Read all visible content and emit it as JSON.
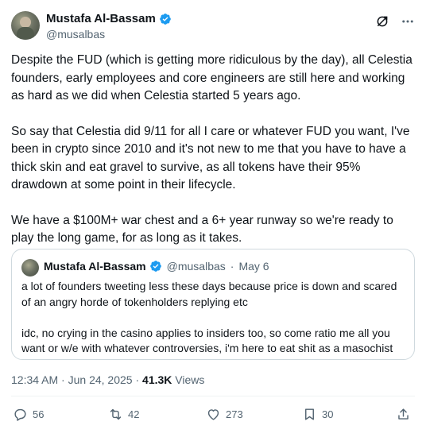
{
  "author": {
    "name": "Mustafa Al-Bassam",
    "handle": "@musalbas"
  },
  "tweet": {
    "paragraphs": [
      "Despite the FUD (which is getting more ridiculous by the day), all Celestia founders, early employees and core engineers are still here and working as hard as we did when Celestia started 5 years ago.",
      "So say that Celestia did 9/11 for all I care or whatever FUD you want, I've been in crypto since 2010 and it's not new to me that you have to have a thick skin and eat gravel to survive, as all tokens have their 95% drawdown at some point in their lifecycle.",
      "We have a $100M+ war chest and a 6+ year runway so we're ready to play the long game, for as long as it takes."
    ]
  },
  "quote": {
    "name": "Mustafa Al-Bassam",
    "handle": "@musalbas",
    "separator": "·",
    "date": "May 6",
    "paragraphs": [
      "a lot of founders tweeting less these days because price is down and scared of an angry horde of tokenholders replying etc",
      "idc, no crying in the casino applies to insiders too, so come ratio me all you want or w/e with whatever controversies, i'm here to eat shit as a masochist"
    ]
  },
  "meta": {
    "time": "12:34 AM",
    "separator1": " · ",
    "date": "Jun 24, 2025",
    "separator2": " · ",
    "views_count": "41.3K",
    "views_label": " Views"
  },
  "actions": {
    "replies": "56",
    "reposts": "42",
    "likes": "273",
    "bookmarks": "30"
  },
  "colors": {
    "text": "#0f1419",
    "secondary": "#536471",
    "verified": "#1d9bf0",
    "border": "#cfd9de"
  },
  "icons": [
    "verified-badge-icon",
    "grok-icon",
    "more-icon",
    "reply-icon",
    "repost-icon",
    "like-icon",
    "bookmark-icon",
    "share-icon"
  ]
}
